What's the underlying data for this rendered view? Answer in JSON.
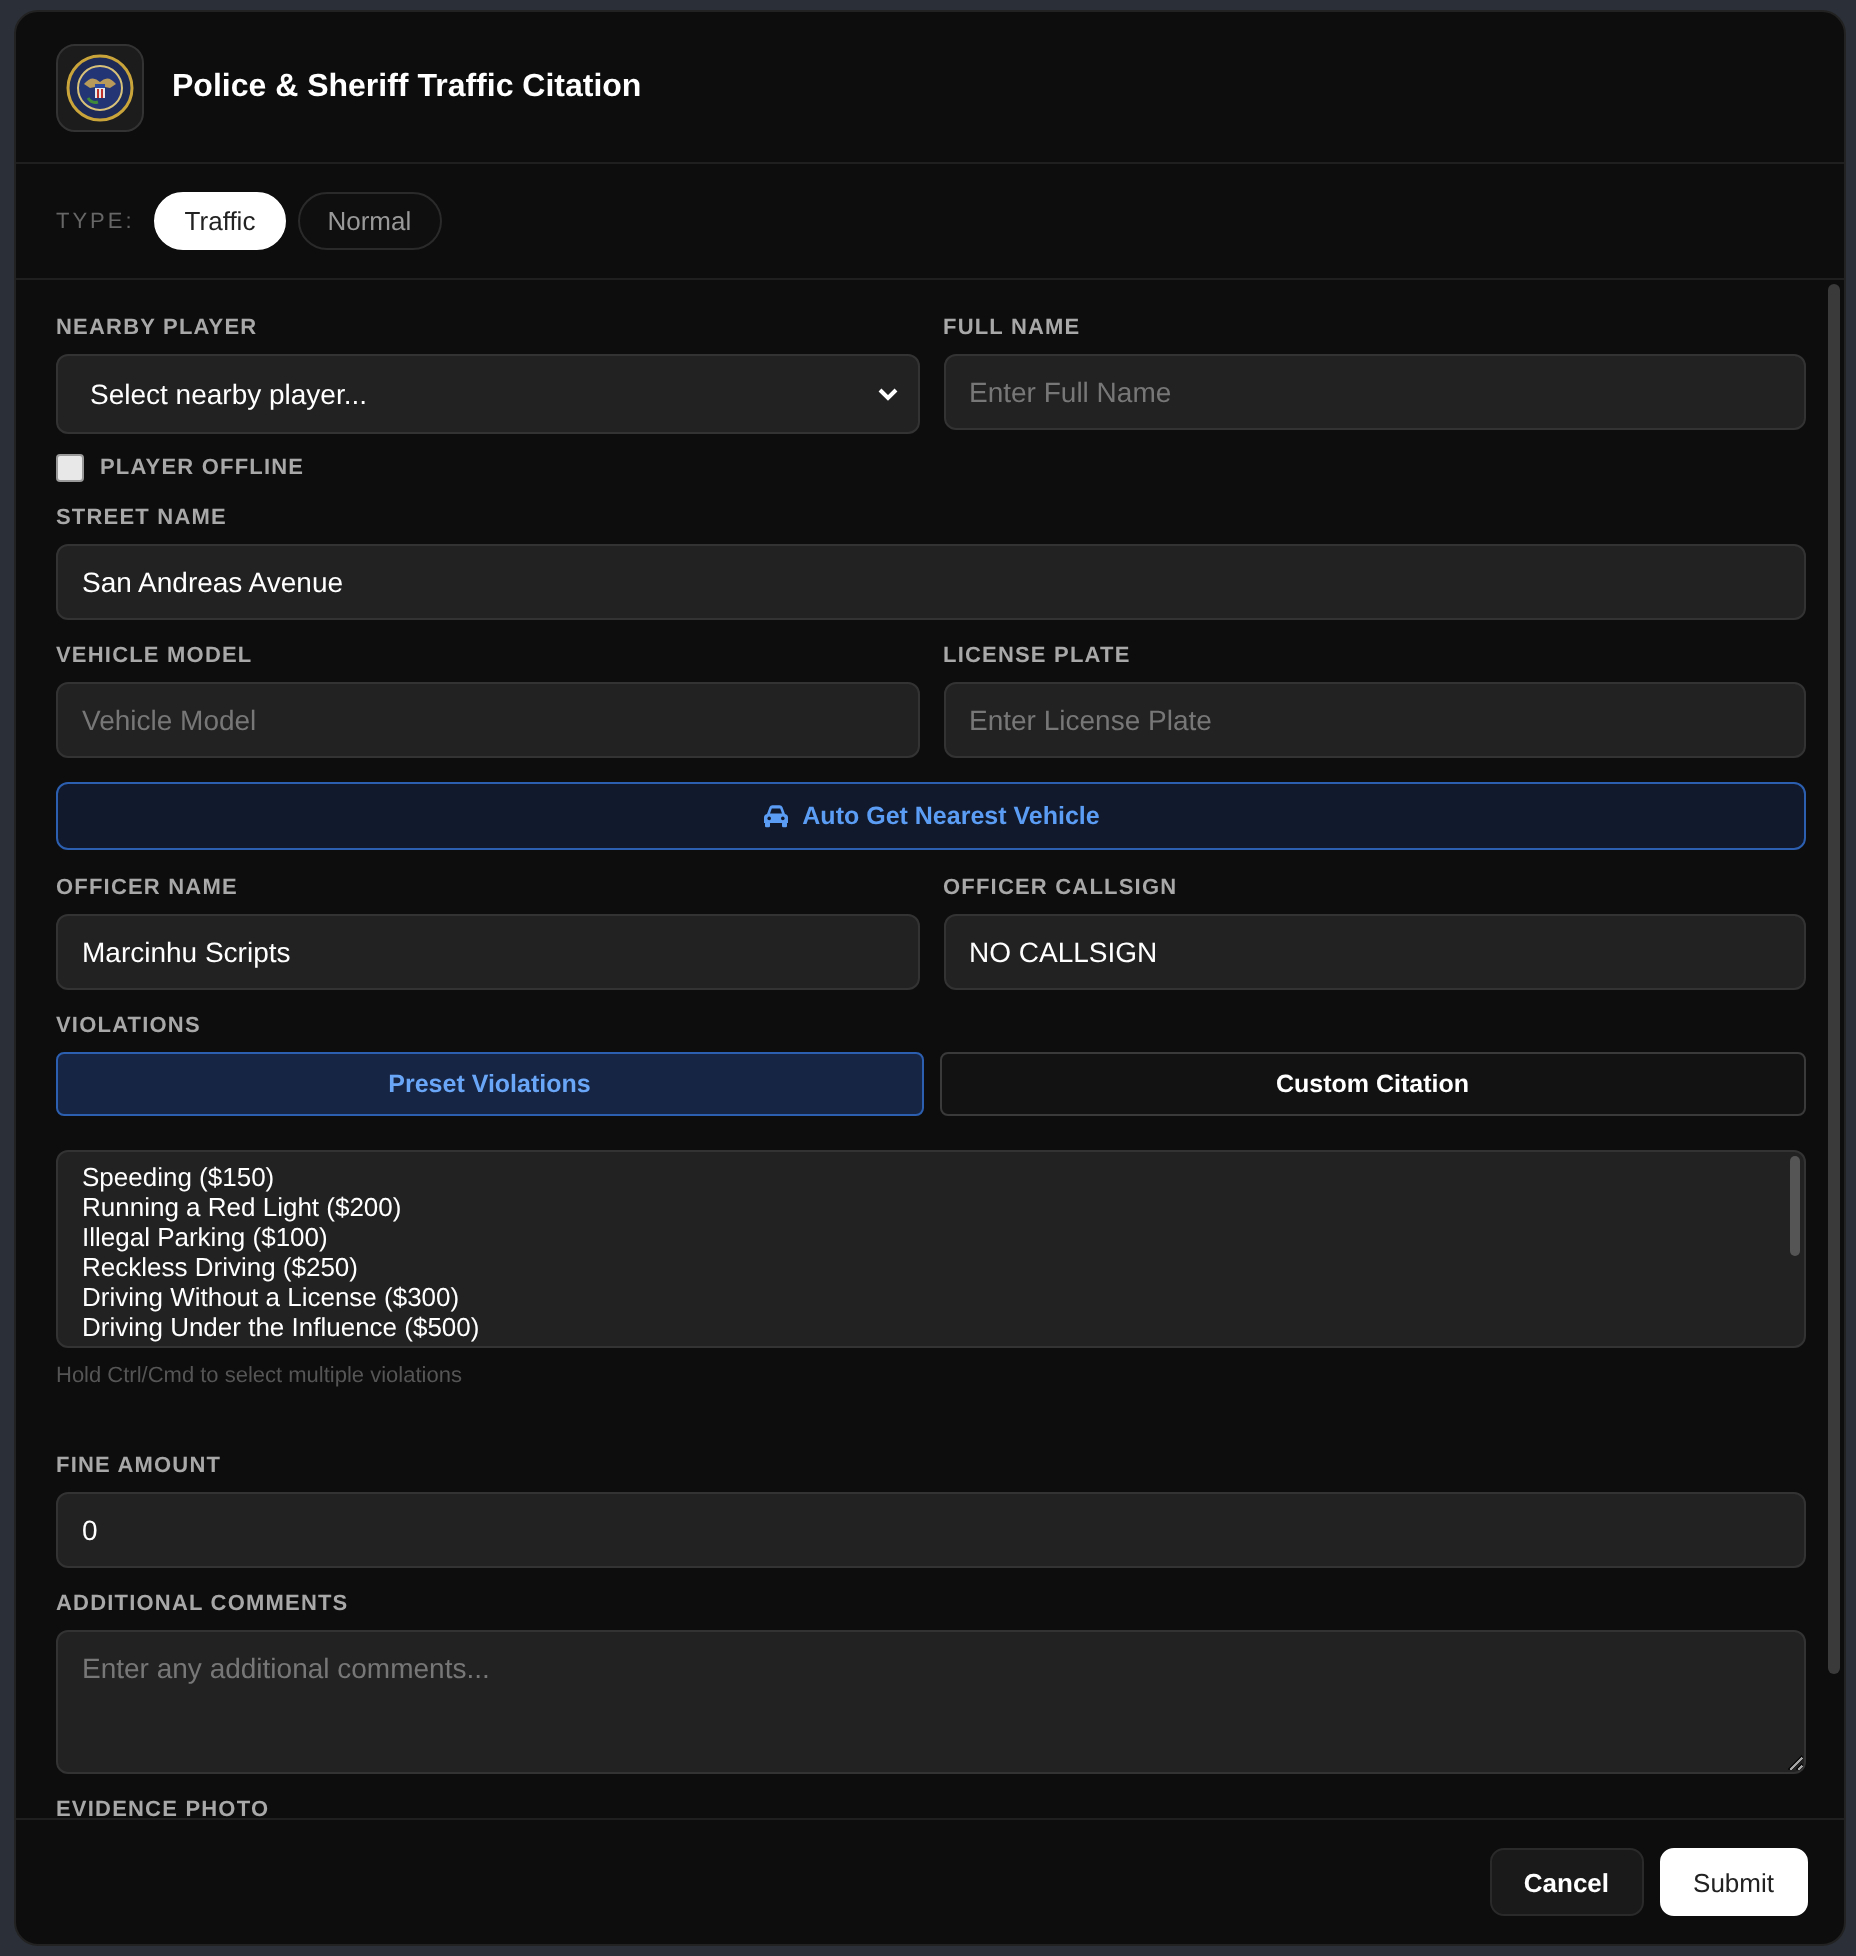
{
  "window": {
    "title": "Police & Sheriff Traffic Citation"
  },
  "type_selector": {
    "label": "TYPE:",
    "options": [
      {
        "label": "Traffic",
        "selected": true
      },
      {
        "label": "Normal",
        "selected": false
      }
    ]
  },
  "form": {
    "nearby_player": {
      "label": "NEARBY PLAYER",
      "value": "Select nearby player..."
    },
    "full_name": {
      "label": "FULL NAME",
      "placeholder": "Enter Full Name"
    },
    "player_offline": {
      "label": "PLAYER OFFLINE",
      "checked": false
    },
    "street_name": {
      "label": "STREET NAME",
      "value": "San Andreas Avenue"
    },
    "vehicle_model": {
      "label": "VEHICLE MODEL",
      "placeholder": "Vehicle Model"
    },
    "license_plate": {
      "label": "LICENSE PLATE",
      "placeholder": "Enter License Plate"
    },
    "auto_vehicle_button": "Auto Get Nearest Vehicle",
    "officer_name": {
      "label": "OFFICER NAME",
      "value": "Marcinhu Scripts"
    },
    "officer_callsign": {
      "label": "OFFICER CALLSIGN",
      "value": "NO CALLSIGN"
    },
    "violations": {
      "label": "VIOLATIONS",
      "tabs": [
        {
          "label": "Preset Violations",
          "selected": true
        },
        {
          "label": "Custom Citation",
          "selected": false
        }
      ],
      "options": [
        "Speeding ($150)",
        "Running a Red Light ($200)",
        "Illegal Parking ($100)",
        "Reckless Driving ($250)",
        "Driving Without a License ($300)",
        "Driving Under the Influence ($500)"
      ],
      "hint": "Hold Ctrl/Cmd to select multiple violations"
    },
    "fine_amount": {
      "label": "FINE AMOUNT",
      "value": "0"
    },
    "additional_comments": {
      "label": "ADDITIONAL COMMENTS",
      "placeholder": "Enter any additional comments..."
    },
    "evidence_photo": {
      "label": "EVIDENCE PHOTO"
    }
  },
  "buttons": [
    {
      "label": "Cancel",
      "kind": "secondary"
    },
    {
      "label": "Submit",
      "kind": "primary"
    }
  ]
}
